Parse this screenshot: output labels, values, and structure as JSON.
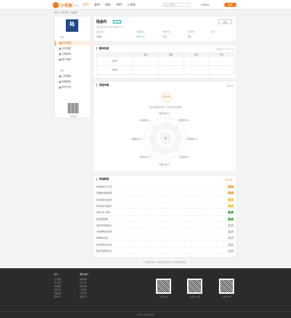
{
  "header": {
    "logo_text": "小老板",
    "logo_sub": "Beta",
    "nav": [
      "首页",
      "查询",
      "商标",
      "律所",
      "小老板"
    ],
    "search_placeholder": "输入关键词",
    "hotline": "咨询热线：",
    "login_label": "登录"
  },
  "breadcrumb": "首页 > 风险评级 > 陆金所",
  "sidebar": {
    "logo_char": "陆",
    "group1": "风险",
    "items1": [
      "风险报告",
      "企业信息",
      "立案查询",
      "财产线索"
    ],
    "group2": "服务",
    "items2": [
      "工商信息",
      "经营风险",
      "知识产权"
    ],
    "qr_caption": "扫码关注"
  },
  "company": {
    "name": "陆金所",
    "tag": "已认证",
    "follow_label": "关注",
    "meta": "成立日期 2011-09-29  注册地 上海",
    "fields": [
      {
        "k": "法定代表人",
        "v": "计葵生"
      },
      {
        "k": "注册资本",
        "v": "83667万元"
      },
      {
        "k": "经营状态",
        "v": "存续"
      },
      {
        "k": "风险评分",
        "v": "暂无"
      },
      {
        "k": "同比",
        "v": "-"
      }
    ]
  },
  "basic_section": {
    "title": "基本信息",
    "note": "数据更新于 2019-07-10",
    "columns": [
      "",
      "项目",
      "数值",
      "同比",
      "评分"
    ],
    "rows": [
      [
        "陆金所",
        "-",
        "-",
        "-",
        "-"
      ],
      [
        "陆金所",
        "-",
        "-",
        "-",
        "-"
      ]
    ]
  },
  "radar": {
    "title": "风险评级",
    "note": "查看详情",
    "score_label": "风险评级",
    "hint": "综合多维数据评估，分值越高风险越低",
    "dimensions": [
      {
        "name": "股东背景",
        "score": "0.0"
      },
      {
        "name": "经营状况",
        "score": "0.0"
      },
      {
        "name": "司法诉讼",
        "score": "0.0"
      },
      {
        "name": "工商变更",
        "score": "0.0"
      },
      {
        "name": "知识产权",
        "score": "0.0"
      },
      {
        "name": "信用记录",
        "score": "0.0"
      },
      {
        "name": "舆情信息",
        "score": "0.0"
      },
      {
        "name": "行业风险",
        "score": "0.0"
      }
    ]
  },
  "risk": {
    "title": "风险报告",
    "count": "共12条",
    "items": [
      {
        "text": "存在被执行人记录",
        "badge": "高",
        "color": "#f0ad4e"
      },
      {
        "text": "近期发生股权变更",
        "badge": "高",
        "color": "#f0ad4e"
      },
      {
        "text": "涉及多起诉讼纠纷",
        "badge": "中",
        "color": "#f5c842"
      },
      {
        "text": "历史存在行政处罚",
        "badge": "中",
        "color": "#f5c842"
      },
      {
        "text": "法定代表人变更",
        "badge": "低",
        "color": "#5cb85c"
      },
      {
        "text": "经营范围调整",
        "badge": "低",
        "color": "#5cb85c"
      },
      {
        "text": "存在对外担保信息",
        "badge": "提示",
        "color": "#cccccc"
      },
      {
        "text": "分支机构经营异常",
        "badge": "提示",
        "color": "#cccccc"
      },
      {
        "text": "注册地址变更",
        "badge": "提示",
        "color": "#cccccc"
      },
      {
        "text": "商标存在争议记录",
        "badge": "提示",
        "color": "#cccccc"
      },
      {
        "text": "知识产权质押信息",
        "badge": "提示",
        "color": "#cccccc"
      }
    ]
  },
  "disclaimer": "以上数据仅供参考，不构成任何投资建议，如有疑问请联系客服。",
  "footer": {
    "col1_title": "关于",
    "col1_items": [
      "关于我们",
      "加入我们",
      "联系我们",
      "服务条款",
      "隐私政策",
      "帮助中心"
    ],
    "col2_title": "联系我们",
    "col2_items": [
      "客服邮箱",
      "商务合作",
      "联系电话",
      "公司地址",
      "工作时间",
      "备案信息"
    ],
    "qrs": [
      "小老板公众号",
      "小老板App下载",
      "小老板小程序"
    ],
    "copyright": "© 2019 小老板 版权所有"
  }
}
